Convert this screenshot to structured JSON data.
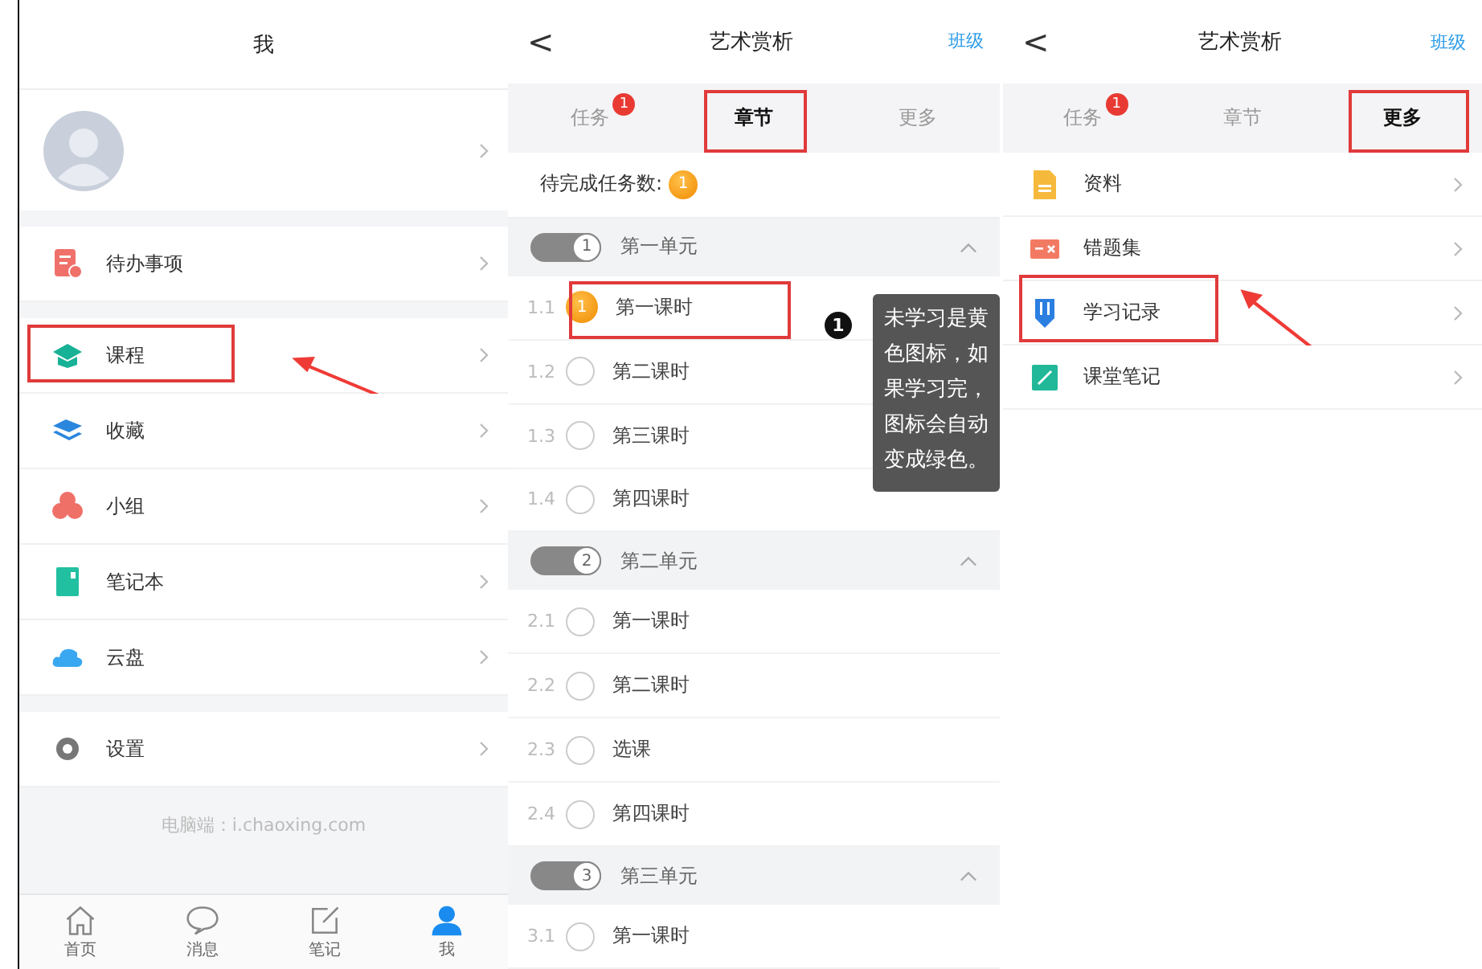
{
  "me_screen": {
    "title": "我",
    "groups": [
      [
        {
          "label": "待办事项",
          "highlighted": false,
          "pointer_arrow": false
        }
      ],
      [
        {
          "label": "课程",
          "highlighted": true,
          "pointer_arrow": true
        },
        {
          "label": "收藏",
          "highlighted": false,
          "pointer_arrow": false
        },
        {
          "label": "小组",
          "highlighted": false,
          "pointer_arrow": false
        },
        {
          "label": "笔记本",
          "highlighted": false,
          "pointer_arrow": false
        },
        {
          "label": "云盘",
          "highlighted": false,
          "pointer_arrow": false
        }
      ],
      [
        {
          "label": "设置",
          "highlighted": false,
          "pointer_arrow": false
        }
      ]
    ],
    "footer": "电脑端：i.chaoxing.com",
    "bottom_tabs": [
      {
        "label": "首页",
        "selected": false
      },
      {
        "label": "消息",
        "selected": false
      },
      {
        "label": "笔记",
        "selected": false
      },
      {
        "label": "我",
        "selected": true
      }
    ]
  },
  "chapter_screen": {
    "back": "<",
    "title": "艺术赏析",
    "class_link": "班级",
    "tabs": [
      {
        "label": "任务",
        "badge": "1",
        "selected": false,
        "highlighted": false
      },
      {
        "label": "章节",
        "selected": true,
        "highlighted": true
      },
      {
        "label": "更多",
        "selected": false,
        "highlighted": false
      }
    ],
    "pending_label": "待完成任务数:",
    "pending_count": "1",
    "units": [
      {
        "number": "1",
        "title": "第一单元",
        "expanded": true,
        "lessons": [
          {
            "number": "1.1",
            "title": "第一课时",
            "kind": "pending",
            "badge": "1",
            "highlighted": true
          },
          {
            "number": "1.2",
            "title": "第二课时",
            "kind": "empty",
            "highlighted": false
          },
          {
            "number": "1.3",
            "title": "第三课时",
            "kind": "empty",
            "highlighted": false
          },
          {
            "number": "1.4",
            "title": "第四课时",
            "kind": "empty",
            "highlighted": false
          }
        ]
      },
      {
        "number": "2",
        "title": "第二单元",
        "expanded": true,
        "lessons": [
          {
            "number": "2.1",
            "title": "第一课时",
            "kind": "empty",
            "highlighted": false
          },
          {
            "number": "2.2",
            "title": "第二课时",
            "kind": "empty",
            "highlighted": false
          },
          {
            "number": "2.3",
            "title": "选课",
            "kind": "empty",
            "highlighted": false
          },
          {
            "number": "2.4",
            "title": "第四课时",
            "kind": "empty",
            "highlighted": false
          }
        ]
      },
      {
        "number": "3",
        "title": "第三单元",
        "expanded": true,
        "lessons": [
          {
            "number": "3.1",
            "title": "第一课时",
            "kind": "empty",
            "highlighted": false
          }
        ]
      }
    ],
    "callout": {
      "number": "1",
      "text": "未学习是黄色图标，如果学习完，图标会自动变成绿色。"
    }
  },
  "more_screen": {
    "back": "<",
    "title": "艺术赏析",
    "class_link": "班级",
    "tabs": [
      {
        "label": "任务",
        "badge": "1",
        "selected": false,
        "highlighted": false
      },
      {
        "label": "章节",
        "selected": false,
        "highlighted": false
      },
      {
        "label": "更多",
        "selected": true,
        "highlighted": true
      }
    ],
    "items": [
      {
        "label": "资料",
        "highlighted": false,
        "pointer_arrow": false
      },
      {
        "label": "错题集",
        "highlighted": false,
        "pointer_arrow": false
      },
      {
        "label": "学习记录",
        "highlighted": true,
        "pointer_arrow": true
      },
      {
        "label": "课堂笔记",
        "highlighted": false,
        "pointer_arrow": false
      }
    ]
  }
}
